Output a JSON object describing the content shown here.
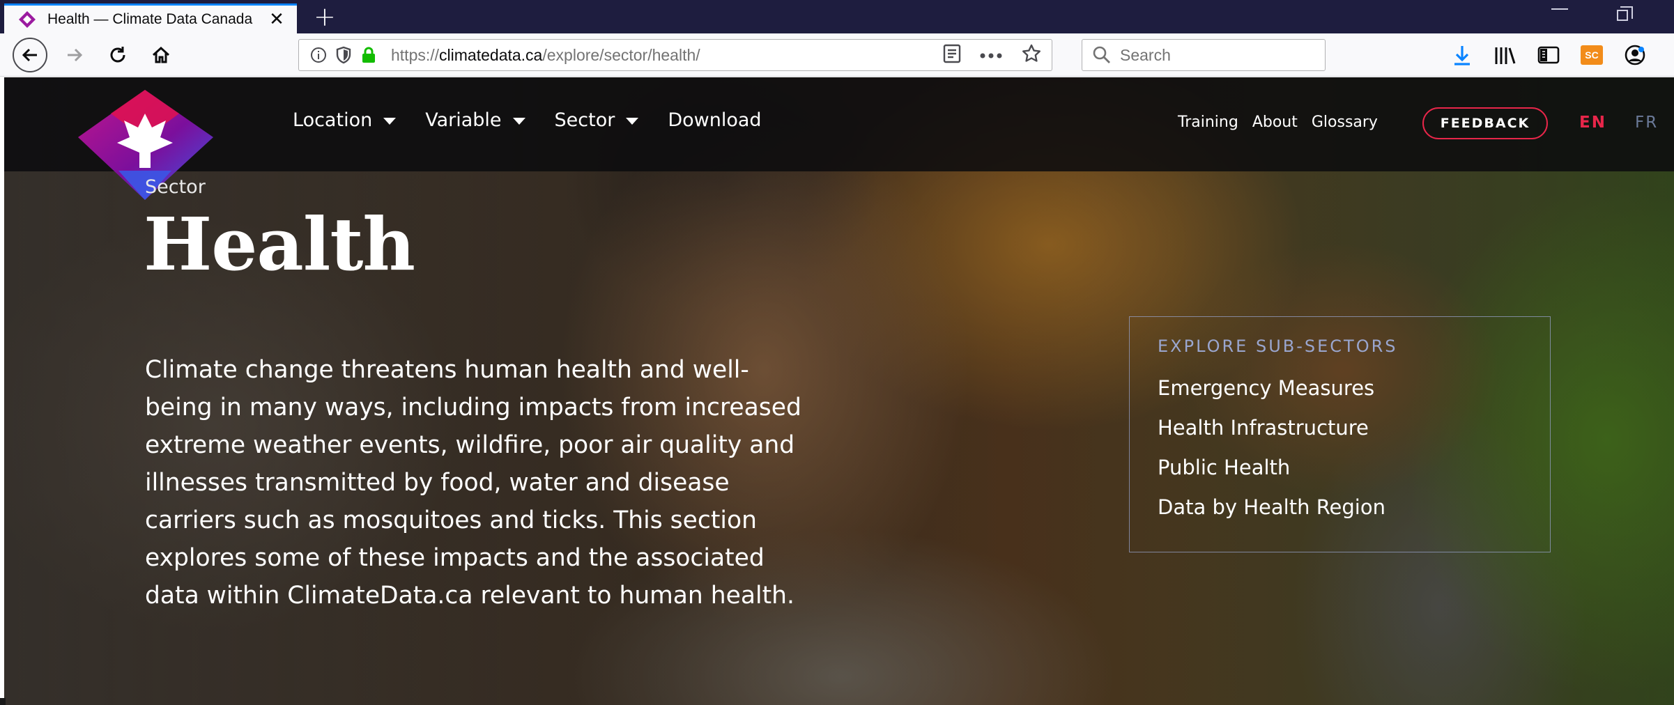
{
  "browser": {
    "tab": {
      "title": "Health — Climate Data Canada"
    },
    "url": {
      "scheme": "https://",
      "host": "climatedata.ca",
      "path": "/explore/sector/health/"
    },
    "search": {
      "placeholder": "Search"
    },
    "icons": {
      "back": "back-arrow-icon",
      "forward": "forward-arrow-icon",
      "reload": "reload-icon",
      "home": "home-icon",
      "info": "info-icon",
      "tracking": "shield-icon",
      "lock": "lock-icon",
      "reader": "reader-view-icon",
      "more": "more-actions-icon",
      "bookmark": "bookmark-star-icon",
      "download": "download-icon",
      "library": "library-icon",
      "sidebar": "sidebar-icon",
      "extension": "extension-icon",
      "account": "account-icon"
    },
    "extension_label": "SC"
  },
  "site": {
    "nav": {
      "location": "Location",
      "variable": "Variable",
      "sector": "Sector",
      "download": "Download"
    },
    "util": {
      "training": "Training",
      "about": "About",
      "glossary": "Glossary"
    },
    "feedback": "FEEDBACK",
    "lang": {
      "en": "EN",
      "fr": "FR"
    },
    "colors": {
      "accent": "#e8264a",
      "logo_purple": "#7b0f9c",
      "logo_magenta": "#c1168c",
      "logo_blue": "#3b56e6"
    }
  },
  "hero": {
    "eyebrow": "Sector",
    "title": "Health",
    "intro": "Climate change threatens human health and well-being in many ways, including impacts from increased extreme weather events, wildfire, poor air quality and illnesses transmitted by food, water and disease carriers such as mosquitoes and ticks. This section explores some of these impacts and the associated data within ClimateData.ca relevant to human health."
  },
  "subsectors": {
    "heading": "EXPLORE SUB-SECTORS",
    "items": [
      {
        "label": "Emergency Measures"
      },
      {
        "label": "Health Infrastructure"
      },
      {
        "label": "Public Health"
      },
      {
        "label": "Data by Health Region"
      }
    ]
  }
}
